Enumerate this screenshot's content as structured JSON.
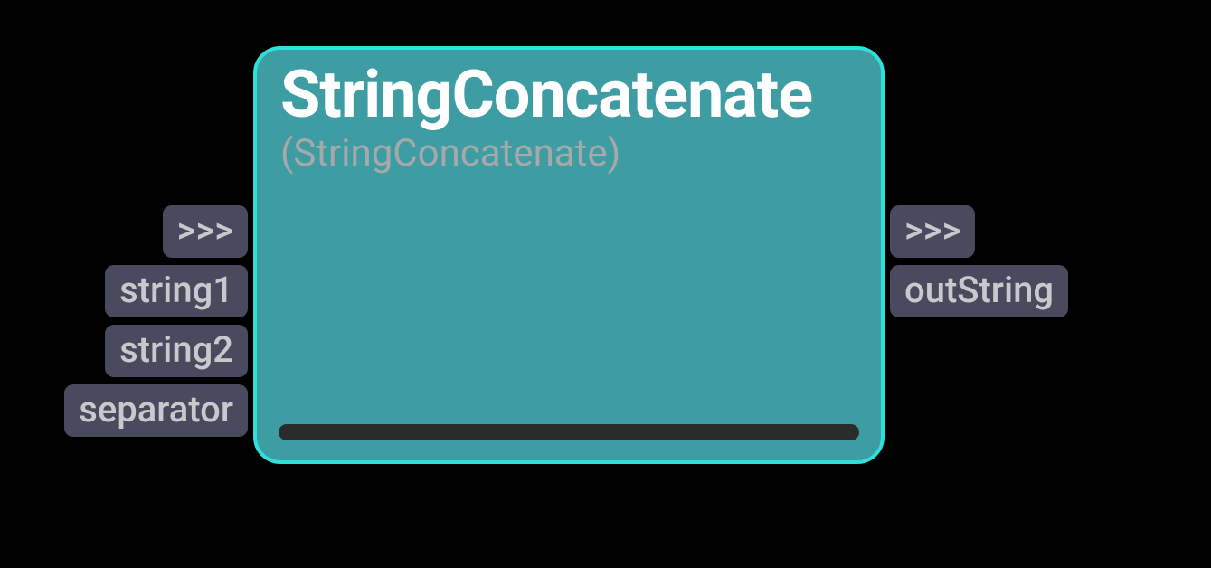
{
  "node": {
    "title": "StringConcatenate",
    "subtitle": "(StringConcatenate)"
  },
  "inputs": {
    "exec": ">>>",
    "string1": "string1",
    "string2": "string2",
    "separator": "separator"
  },
  "outputs": {
    "exec": ">>>",
    "outString": "outString"
  }
}
